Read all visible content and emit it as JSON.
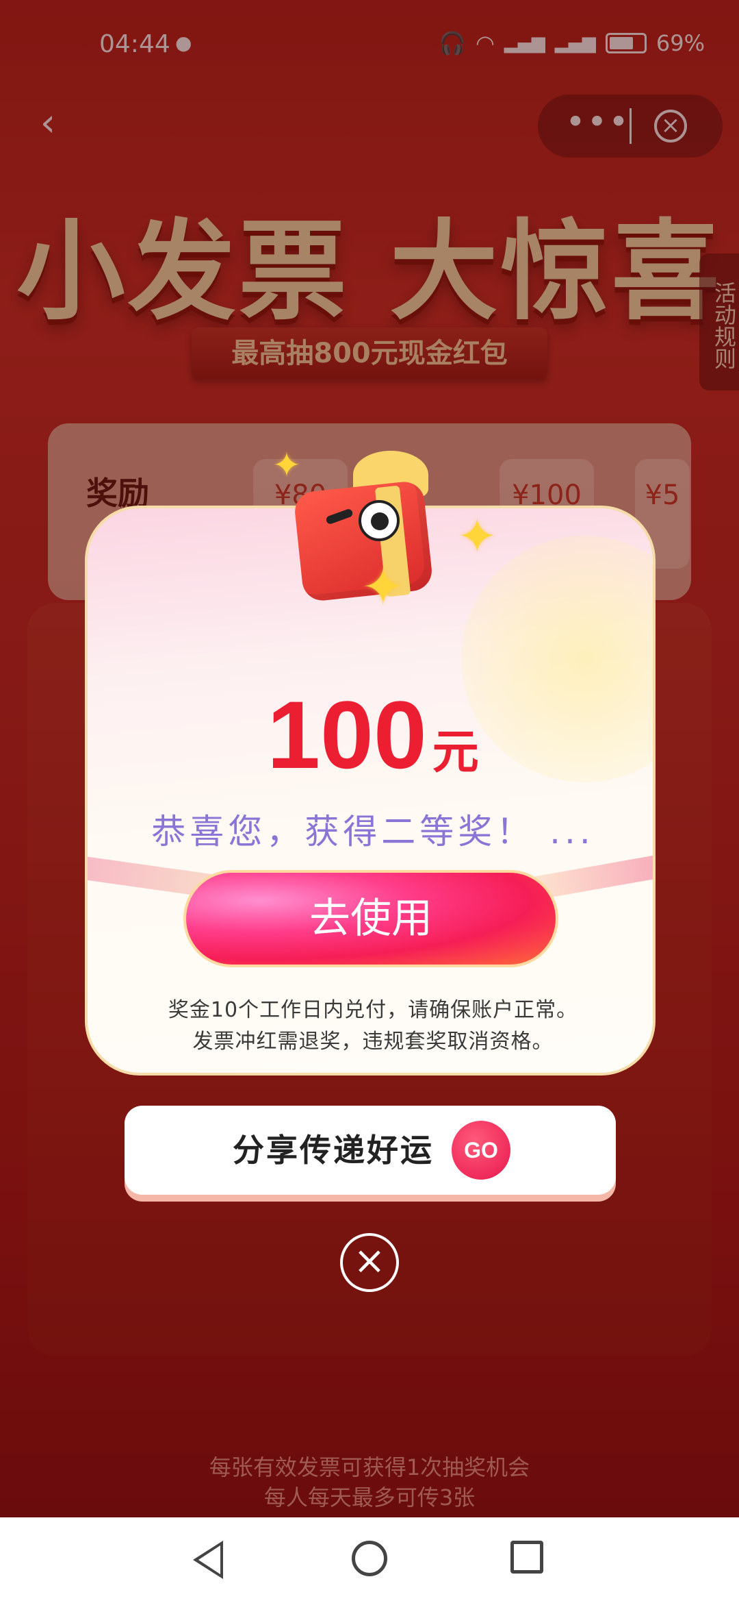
{
  "status_bar": {
    "time": "04:44",
    "battery_percent": "69%",
    "icons": [
      "wechat-icon",
      "headphones-icon",
      "wifi-icon",
      "4g-signal-icon",
      "4g-signal-icon",
      "battery-icon"
    ]
  },
  "top_bar": {
    "back_icon": "chevron-left-icon",
    "more_icon": "more-dots-icon",
    "close_icon": "close-circle-icon"
  },
  "banner": {
    "title": "小发票 大惊喜",
    "subtitle": "最高抽800元现金红包",
    "rules_tab": "活动规则"
  },
  "prize_strip": {
    "label": "奖励",
    "cards": [
      "¥80",
      "¥100",
      "¥5"
    ]
  },
  "modal": {
    "amount": "100",
    "unit": "元",
    "congrats": "恭喜您，获得二等奖！ ...",
    "use_button": "去使用",
    "note_line1": "奖金10个工作日内兑付，请确保账户正常。",
    "note_line2": "发票冲红需退奖，违规套奖取消资格。"
  },
  "share": {
    "label": "分享传递好运",
    "go": "GO"
  },
  "footer": {
    "line1": "每张有效发票可获得1次抽奖机会",
    "line2": "每人每天最多可传3张"
  },
  "colors": {
    "accent_red": "#ec1f32",
    "congrats_purple": "#8a75d6",
    "button_pink": "#f61e56"
  }
}
